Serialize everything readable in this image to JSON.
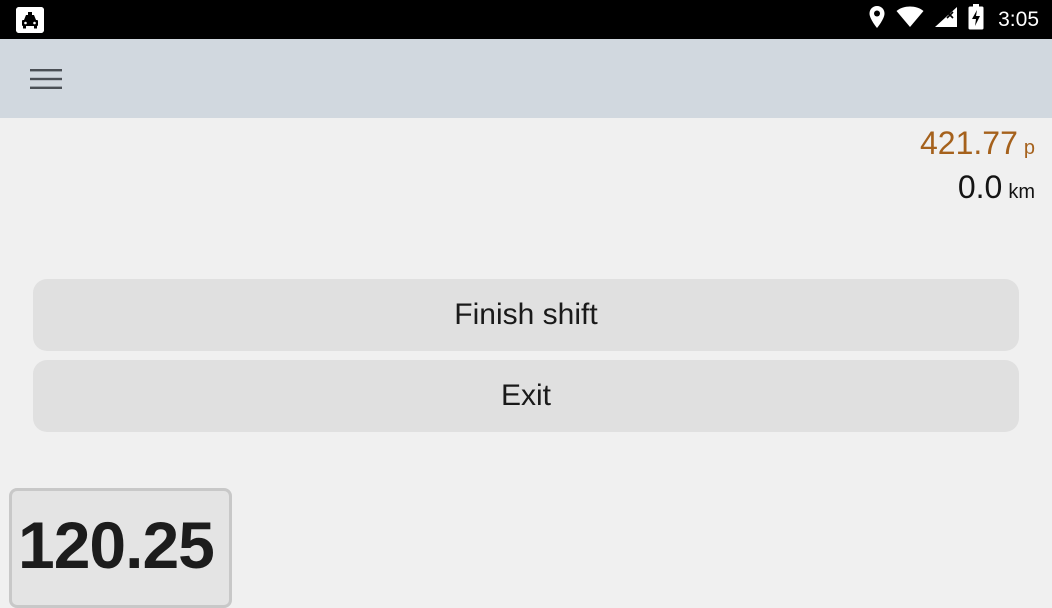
{
  "status_bar": {
    "time": "3:05",
    "icons": [
      "taxi-app-icon",
      "location-icon",
      "wifi-icon",
      "signal-icon",
      "battery-charging-icon"
    ]
  },
  "toolbar": {
    "menu_icon": "hamburger-menu-icon"
  },
  "metrics": {
    "amount_value": "421.77",
    "amount_unit": "р",
    "distance_value": "0.0",
    "distance_unit": "km"
  },
  "actions": {
    "finish_shift_label": "Finish shift",
    "exit_label": "Exit"
  },
  "fare": {
    "value": "120.25"
  },
  "colors": {
    "amount": "#a5611c",
    "toolbar_bg": "#d1d8df",
    "button_bg": "#e0e0e0"
  }
}
